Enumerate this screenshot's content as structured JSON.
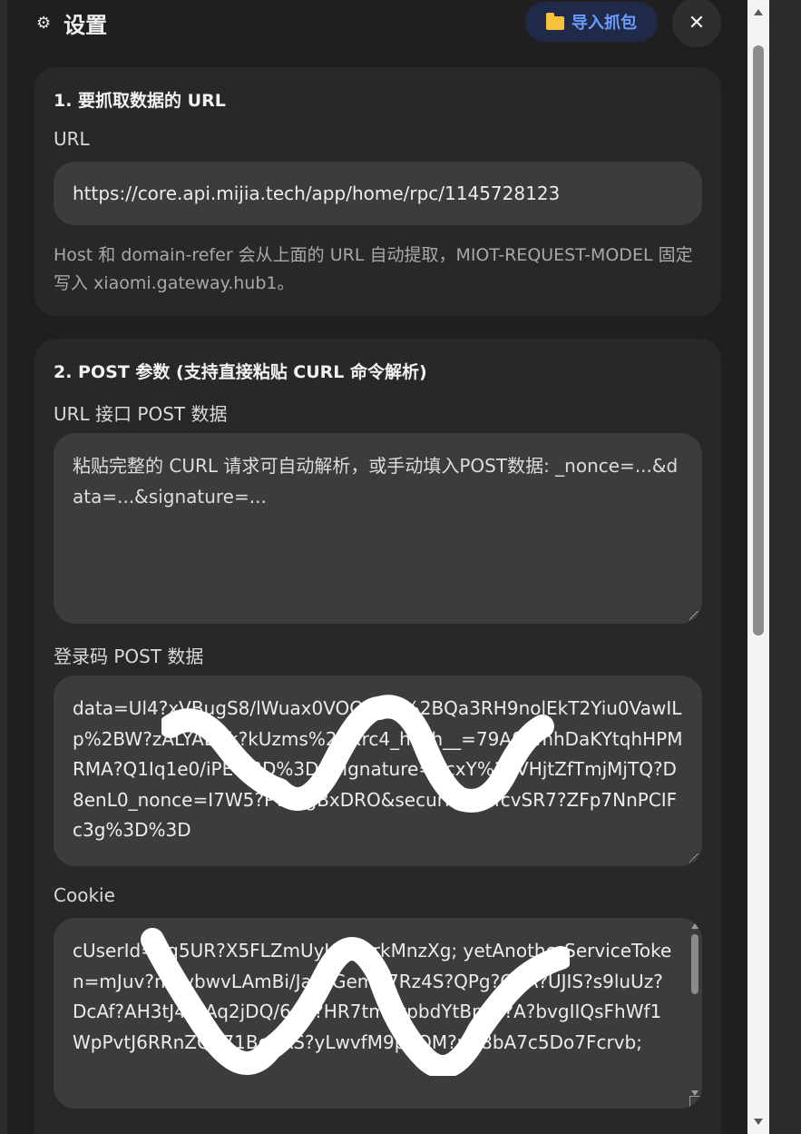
{
  "header": {
    "gear_icon": "gear-icon",
    "title": "设置",
    "import_label": "导入抓包",
    "folder_icon": "folder-icon",
    "close_symbol": "✕"
  },
  "section1": {
    "title": "1. 要抓取数据的 URL",
    "url_label": "URL",
    "url_value": "https://core.api.mijia.tech/app/home/rpc/1145728123",
    "hint": "Host 和 domain-refer 会从上面的 URL 自动提取，MIOT-REQUEST-MODEL 固定写入 xiaomi.gateway.hub1。"
  },
  "section2": {
    "title": "2. POST 参数 (支持直接粘贴 CURL 命令解析)",
    "post_label": "URL 接口 POST 数据",
    "post_placeholder": "粘贴完整的 CURL 请求可自动解析，或手动填入POST数据: _nonce=...&data=...&signature=...",
    "login_label": "登录码 POST 数据",
    "login_value": "data=Ul4?xVBugS8/lWuax0VOQYxrs%2BQa3RH9nolEkT2Yiu0VawILp%2BW?zALYALOk?kUzms%2F&rc4_hash__=79A0VmhDaKYtqhHPMRMA?Q1Iq1e0/iPE%3D%3D&signature=qcxY%2FVHjtZfTmjMjTQ?D8enL0_nonce=I7W5?PWXgBxDRO&security=bfcvSR7?ZFp7NnPCIFc3g%3D%3D",
    "cookie_label": "Cookie",
    "cookie_value": "cUserId=oq5UR?X5FLZmUyUV6arkMnzXg; yetAnotherServiceToken=mJuv?m0ybwvLAmBi/JaCrGemA7Rz4S?QPg?OpA?UJIS?s9luUz?DcAf?AH3tJ4r0Aq2jDQ/6dS?HR7tm?ypbdYtBpso?A?bvgIIQsFhWf1WpPvtJ6RRnZQu71BodAS?yLwvfM9pdOM?uZ8bA7c5Do7Fcrvb;"
  },
  "colors": {
    "background": "#1f1f1f",
    "card": "#282828",
    "field": "#3c3c3c",
    "accent": "#6a9cff",
    "folder": "#f5c23a"
  }
}
